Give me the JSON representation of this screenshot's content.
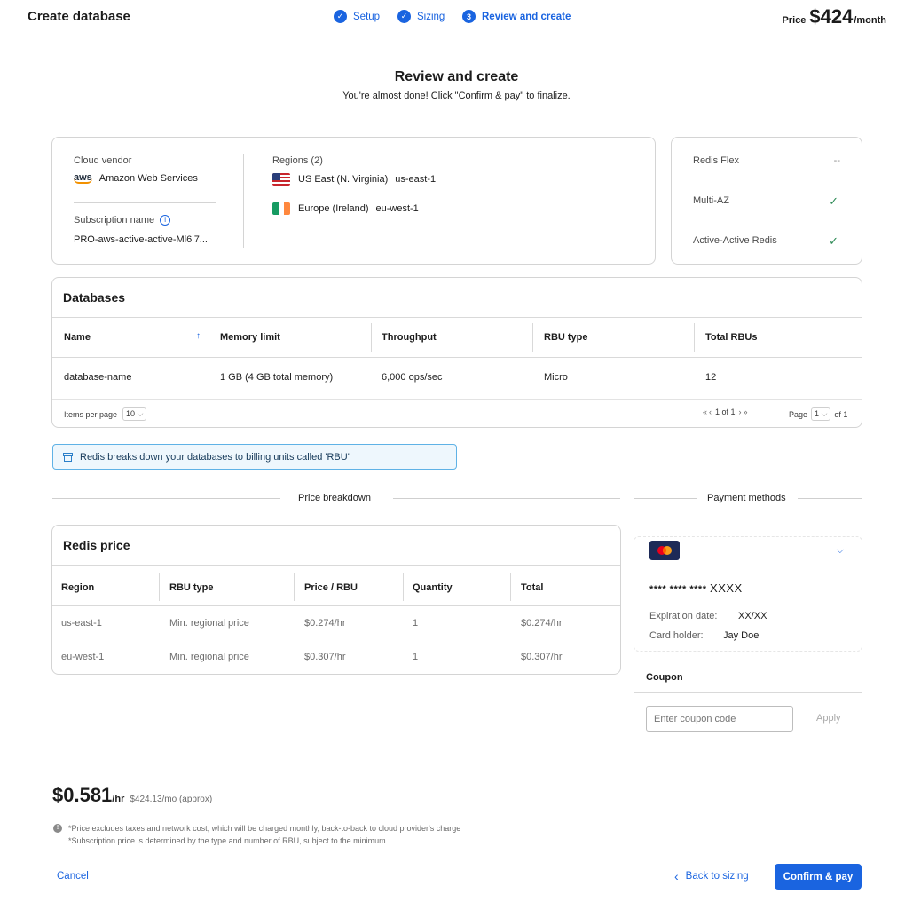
{
  "header": {
    "title": "Create database",
    "steps": [
      {
        "label": "Setup",
        "state": "done"
      },
      {
        "label": "Sizing",
        "state": "done"
      },
      {
        "label": "Review and create",
        "number": "3",
        "state": "active"
      }
    ],
    "price_label": "Price",
    "price_value": "$424",
    "price_period": "/month"
  },
  "page": {
    "title": "Review and create",
    "subtitle": "You're almost done! Click \"Confirm & pay\" to finalize."
  },
  "summary": {
    "cloud_vendor_label": "Cloud vendor",
    "cloud_vendor_logo": "aws",
    "cloud_vendor_value": "Amazon Web Services",
    "subscription_label": "Subscription name",
    "subscription_value": "PRO-aws-active-active-Ml6l7...",
    "regions_label": "Regions (2)",
    "regions": [
      {
        "name": "US East (N. Virginia)",
        "code": "us-east-1",
        "flag": "us"
      },
      {
        "name": "Europe (Ireland)",
        "code": "eu-west-1",
        "flag": "ie"
      }
    ]
  },
  "features": [
    {
      "label": "Redis Flex",
      "value": "--"
    },
    {
      "label": "Multi-AZ",
      "value": "✓"
    },
    {
      "label": "Active-Active Redis",
      "value": "✓"
    }
  ],
  "databases": {
    "title": "Databases",
    "columns": [
      "Name",
      "Memory limit",
      "Throughput",
      "RBU type",
      "Total RBUs"
    ],
    "rows": [
      [
        "database-name",
        "1 GB (4 GB total memory)",
        "6,000 ops/sec",
        "Micro",
        "12"
      ]
    ],
    "items_per_page_label": "Items per page",
    "items_per_page_value": "10",
    "range_text": "1 of 1",
    "page_label": "Page",
    "page_value": "1",
    "page_total": "of 1"
  },
  "banner": {
    "text": "Redis breaks down your databases to billing units called 'RBU'"
  },
  "sections": {
    "price_breakdown": "Price breakdown",
    "payment_methods": "Payment methods"
  },
  "redis_price": {
    "title": "Redis price",
    "columns": [
      "Region",
      "RBU type",
      "Price / RBU",
      "Quantity",
      "Total"
    ],
    "rows": [
      [
        "us-east-1",
        "Min. regional price",
        "$0.274/hr",
        "1",
        "$0.274/hr"
      ],
      [
        "eu-west-1",
        "Min. regional price",
        "$0.307/hr",
        "1",
        "$0.307/hr"
      ]
    ]
  },
  "payment": {
    "card_brand": "mastercard",
    "card_number": "**** **** ****",
    "card_last": "XXXX",
    "expiration_label": "Expiration date:",
    "expiration_value": "XX/XX",
    "holder_label": "Card holder:",
    "holder_value": "Jay Doe"
  },
  "coupon": {
    "title": "Coupon",
    "placeholder": "Enter coupon code",
    "apply_label": "Apply"
  },
  "total": {
    "hourly": "$0.581",
    "hourly_unit": "/hr",
    "monthly": "$424.13/mo (approx)",
    "note1": "*Price excludes taxes and network cost, which will be charged monthly, back-to-back to cloud provider's charge",
    "note2": "*Subscription price is determined by the type and number of RBU, subject to the minimum"
  },
  "footer": {
    "cancel_label": "Cancel",
    "back_label": "Back to sizing",
    "confirm_label": "Confirm & pay"
  },
  "colors": {
    "accent": "#1a64e0",
    "check": "#2e8b57",
    "banner_border": "#5fb2e6"
  }
}
